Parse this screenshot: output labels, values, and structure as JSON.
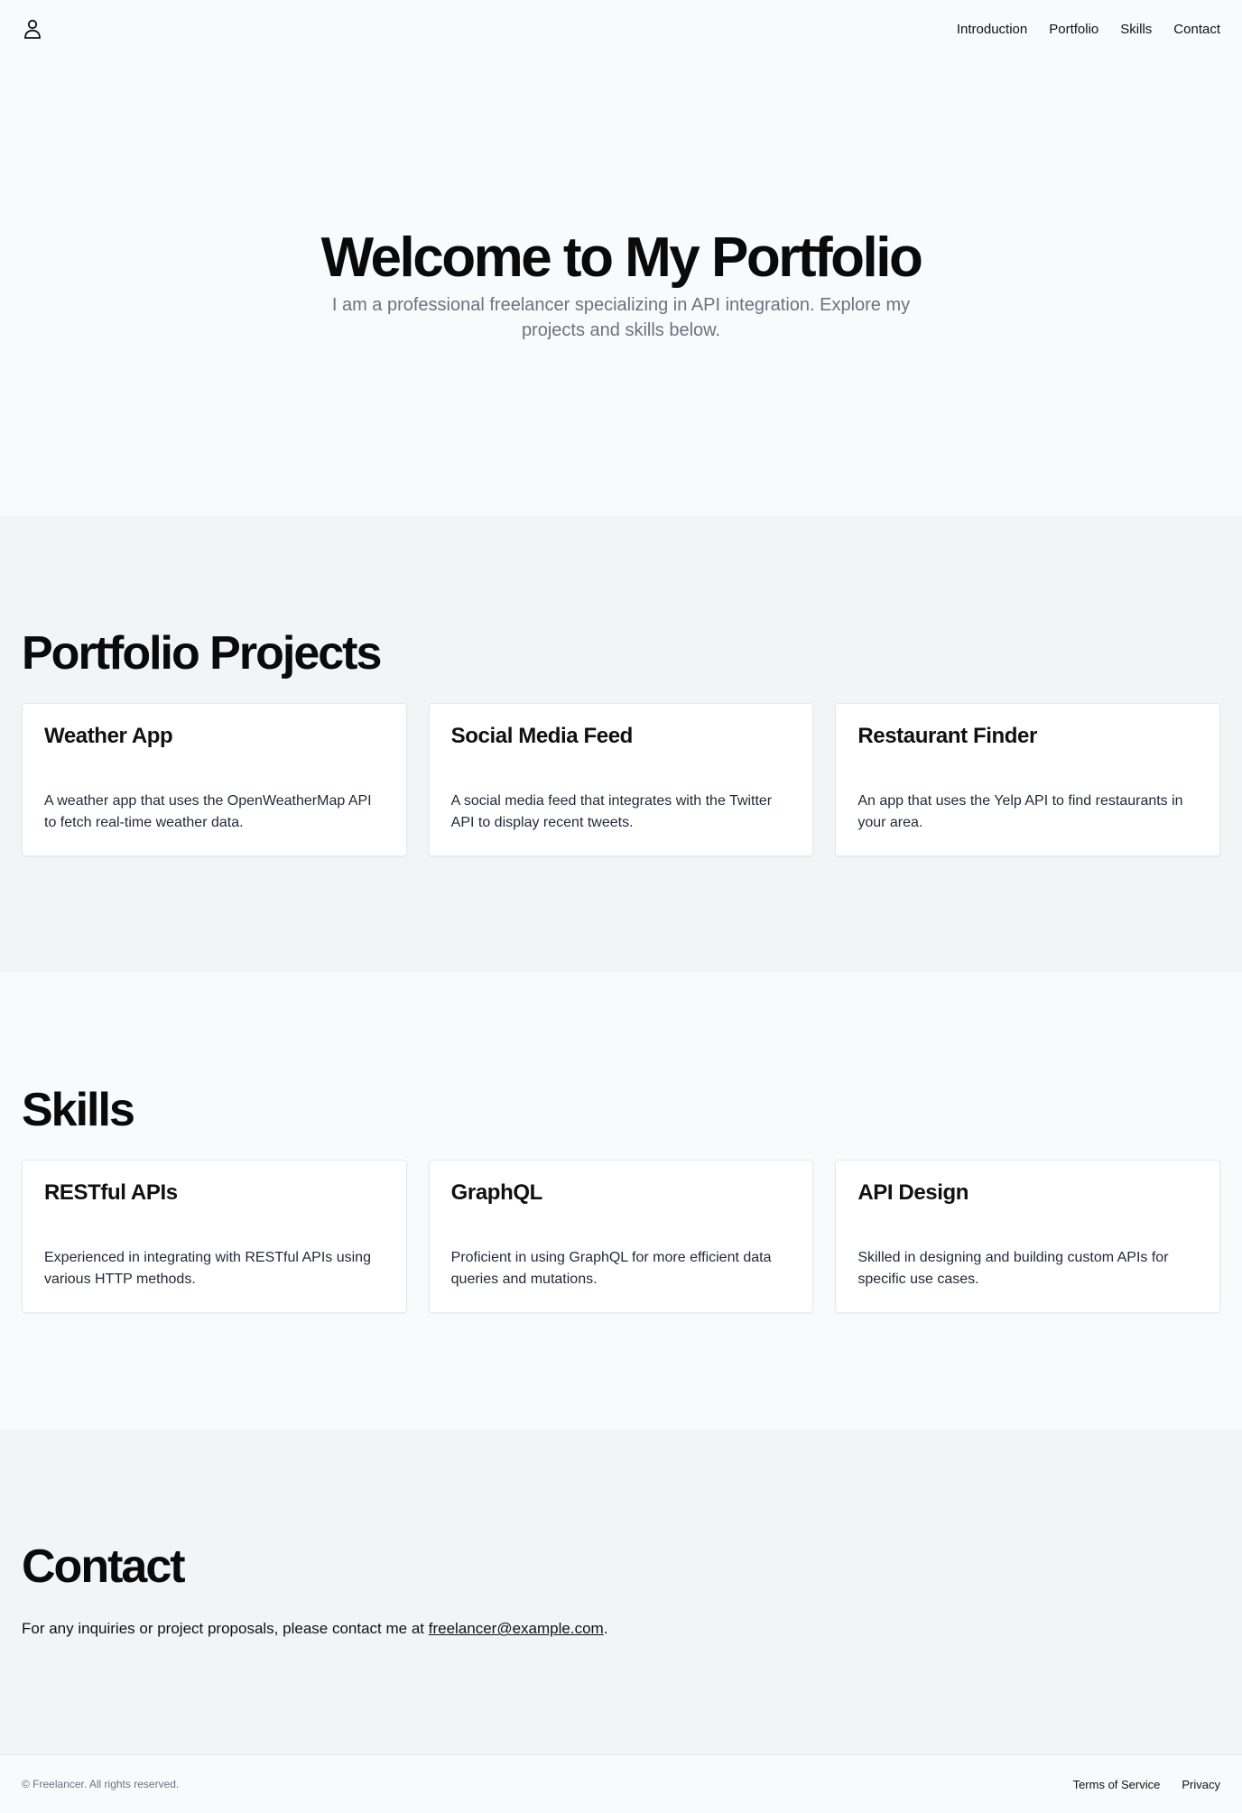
{
  "header": {
    "logo_icon": "user-icon",
    "nav": [
      {
        "label": "Introduction"
      },
      {
        "label": "Portfolio"
      },
      {
        "label": "Skills"
      },
      {
        "label": "Contact"
      }
    ]
  },
  "hero": {
    "title": "Welcome to My Portfolio",
    "subtitle": "I am a professional freelancer specializing in API integration. Explore my projects and skills below."
  },
  "portfolio": {
    "title": "Portfolio Projects",
    "cards": [
      {
        "title": "Weather App",
        "description": "A weather app that uses the OpenWeatherMap API to fetch real-time weather data."
      },
      {
        "title": "Social Media Feed",
        "description": "A social media feed that integrates with the Twitter API to display recent tweets."
      },
      {
        "title": "Restaurant Finder",
        "description": "An app that uses the Yelp API to find restaurants in your area."
      }
    ]
  },
  "skills": {
    "title": "Skills",
    "cards": [
      {
        "title": "RESTful APIs",
        "description": "Experienced in integrating with RESTful APIs using various HTTP methods."
      },
      {
        "title": "GraphQL",
        "description": "Proficient in using GraphQL for more efficient data queries and mutations."
      },
      {
        "title": "API Design",
        "description": "Skilled in designing and building custom APIs for specific use cases."
      }
    ]
  },
  "contact": {
    "title": "Contact",
    "text_before": "For any inquiries or project proposals, please contact me at ",
    "email": "freelancer@example.com",
    "text_after": "."
  },
  "footer": {
    "copyright": "© Freelancer. All rights reserved.",
    "links": [
      {
        "label": "Terms of Service"
      },
      {
        "label": "Privacy"
      }
    ]
  },
  "colors": {
    "page_bg": "#f9fafb",
    "alt_section_bg": "#f3f4f6",
    "card_bg": "#ffffff",
    "muted_text": "#6b7280"
  }
}
